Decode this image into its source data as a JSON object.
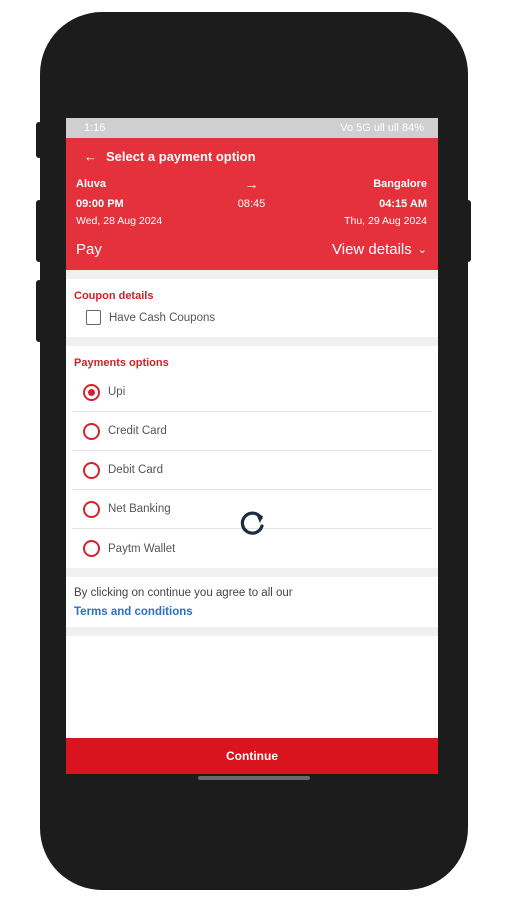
{
  "status_bar": {
    "time": "1:16",
    "indicators": "Vo 5G ull ull 84%"
  },
  "header": {
    "back_icon": "←",
    "title": "Select a payment option",
    "origin": {
      "city": "Aluva",
      "time": "09:00 PM",
      "date": "Wed, 28 Aug 2024"
    },
    "arrow_icon": "→",
    "duration": "08:45",
    "destination": {
      "city": "Bangalore",
      "time": "04:15 AM",
      "date": "Thu, 29 Aug 2024"
    },
    "pay_label": "Pay",
    "view_details_label": "View details",
    "chevron_icon": "⌄"
  },
  "coupon": {
    "title": "Coupon details",
    "checkbox_label": "Have Cash Coupons",
    "checked": false
  },
  "payments": {
    "title": "Payments options",
    "selected": "Upi",
    "options": [
      "Upi",
      "Credit Card",
      "Debit Card",
      "Net Banking",
      "Paytm Wallet"
    ]
  },
  "terms": {
    "text": "By clicking on continue you agree to all our",
    "link": "Terms and conditions"
  },
  "continue_label": "Continue",
  "colors": {
    "brand_red": "#e5313b",
    "continue_red": "#d9141e",
    "link_blue": "#2d6fc9"
  }
}
